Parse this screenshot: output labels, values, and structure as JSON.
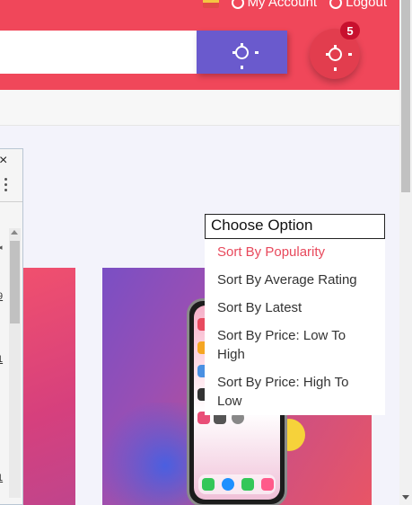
{
  "header": {
    "my_account": "My Account",
    "logout": "Logout",
    "cart_count": "5",
    "search_placeholder": ""
  },
  "sort_dropdown": {
    "selected": "Choose Option",
    "options": [
      "Sort By Popularity",
      "Sort By Average Rating",
      "Sort By Latest",
      "Sort By Price: Low To High",
      "Sort By Price: High To Low"
    ],
    "highlighted_index": 0
  },
  "left_panel": {
    "close": "×",
    "numbers": [
      "9",
      "1",
      "1"
    ]
  },
  "colors": {
    "header": "#f0475a",
    "search_button": "#6a5acd",
    "highlight": "#e8495c"
  }
}
